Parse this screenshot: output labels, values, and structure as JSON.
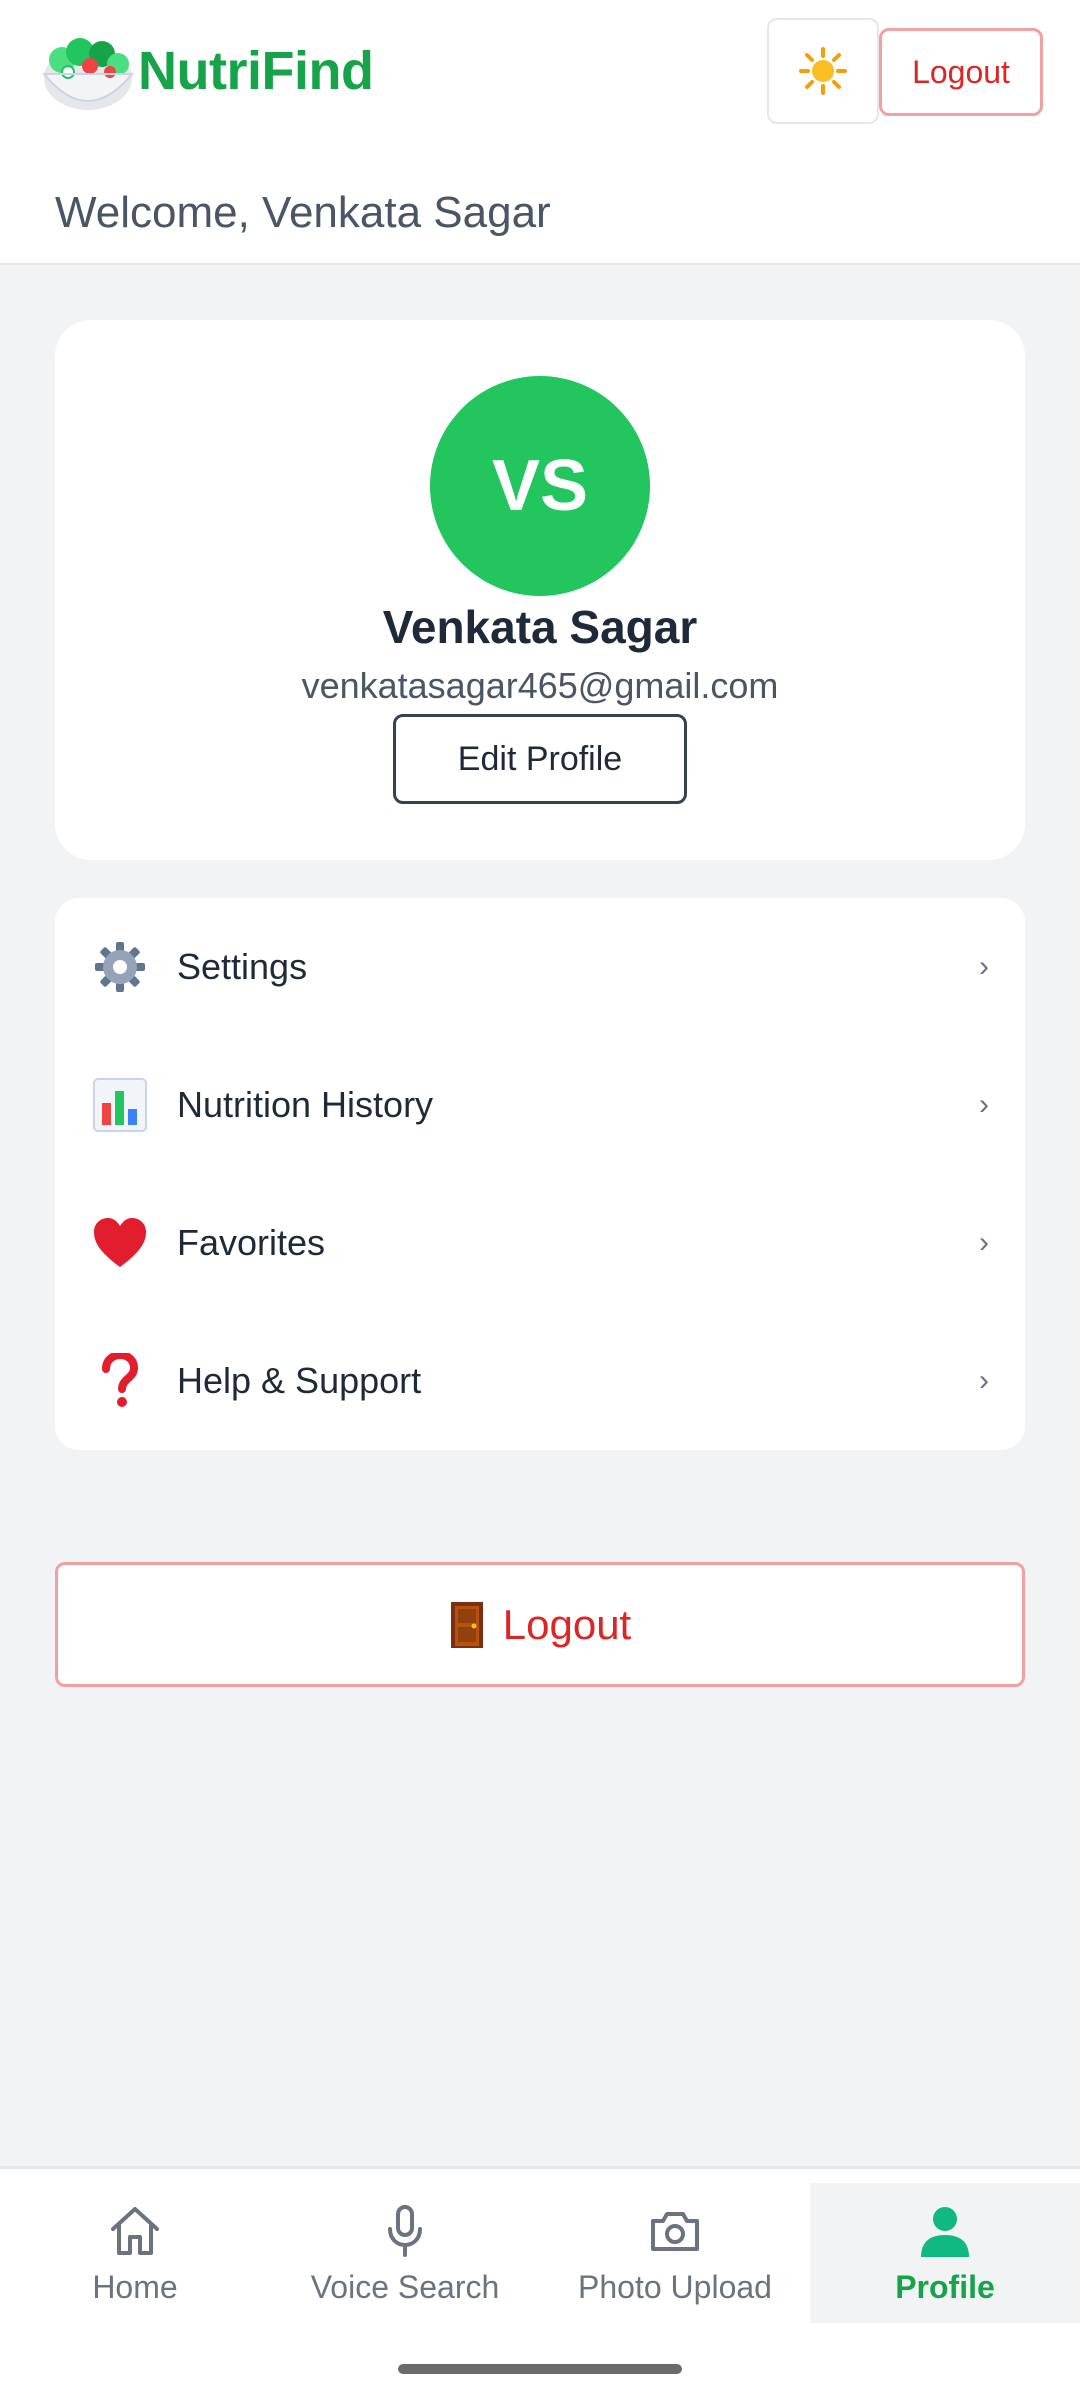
{
  "header": {
    "app_name": "NutriFind",
    "theme_toggle_icon": "sun-icon",
    "logout_label": "Logout",
    "welcome_text": "Welcome, Venkata Sagar"
  },
  "profile": {
    "initials": "VS",
    "name": "Venkata Sagar",
    "email": "venkatasagar465@gmail.com",
    "edit_label": "Edit Profile",
    "avatar_color": "#22c55e"
  },
  "menu": {
    "items": [
      {
        "label": "Settings",
        "icon": "gear-icon"
      },
      {
        "label": "Nutrition History",
        "icon": "bar-chart-icon"
      },
      {
        "label": "Favorites",
        "icon": "heart-icon"
      },
      {
        "label": "Help & Support",
        "icon": "question-icon"
      }
    ],
    "chevron": "›"
  },
  "logout_button": {
    "label": "Logout",
    "icon": "door-icon"
  },
  "bottom_nav": {
    "items": [
      {
        "label": "Home",
        "icon": "home-icon"
      },
      {
        "label": "Voice Search",
        "icon": "microphone-icon"
      },
      {
        "label": "Photo Upload",
        "icon": "camera-icon"
      },
      {
        "label": "Profile",
        "icon": "user-icon"
      }
    ],
    "active": "Profile"
  },
  "colors": {
    "brand": "#16a34a",
    "danger": "#dc2626",
    "background": "#f2f3f5"
  }
}
